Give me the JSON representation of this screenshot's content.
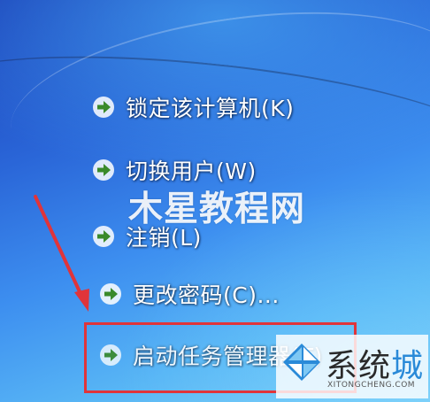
{
  "menu": {
    "items": [
      {
        "label": "锁定该计算机(K)",
        "icon": "green-arrow-icon"
      },
      {
        "label": "切换用户(W)",
        "icon": "green-arrow-icon"
      },
      {
        "label": "注销(L)",
        "icon": "green-arrow-icon"
      },
      {
        "label": "更改密码(C)...",
        "icon": "green-arrow-icon"
      },
      {
        "label": "启动任务管理器(T)",
        "icon": "green-arrow-icon"
      }
    ]
  },
  "watermarks": {
    "center": "木星教程网",
    "corner_brand": "系统",
    "corner_brand_accent": "城",
    "corner_sub": "XITONGCHENG.COM"
  },
  "colors": {
    "arrow_green": "#3a8a2a",
    "highlight_red": "#e0343a",
    "background_blue": "#2a66d8"
  }
}
